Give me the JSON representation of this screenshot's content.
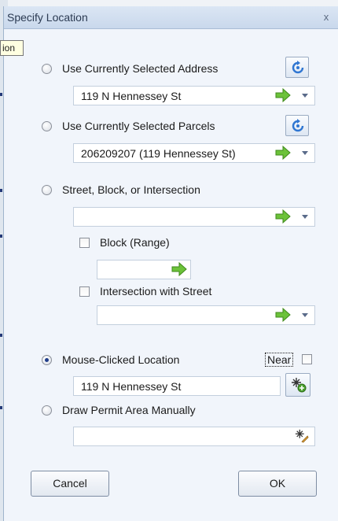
{
  "window": {
    "title": "Specify Location",
    "close_label": "x"
  },
  "tooltip": {
    "text": "ion"
  },
  "options": {
    "address": {
      "label": "Use Currently Selected Address",
      "value": "119 N Hennessey St"
    },
    "parcels": {
      "label": "Use Currently Selected Parcels",
      "value": "206209207 (119 Hennessey St)"
    },
    "street": {
      "label": "Street, Block, or Intersection",
      "value": ""
    },
    "block": {
      "label": "Block (Range)",
      "value": ""
    },
    "intersection": {
      "label": "Intersection with Street",
      "value": ""
    },
    "mouse": {
      "label": "Mouse-Clicked Location",
      "value": "119 N Hennessey St",
      "near_label": "Near"
    },
    "draw": {
      "label": "Draw Permit Area Manually",
      "value": ""
    }
  },
  "buttons": {
    "cancel": "Cancel",
    "ok": "OK"
  },
  "colors": {
    "arrow_green": "#6cc23a",
    "refresh_blue": "#2f76d2"
  },
  "icons": [
    "refresh-icon",
    "go-arrow-icon",
    "dropdown-arrow-icon",
    "map-click-icon",
    "draw-area-icon"
  ]
}
